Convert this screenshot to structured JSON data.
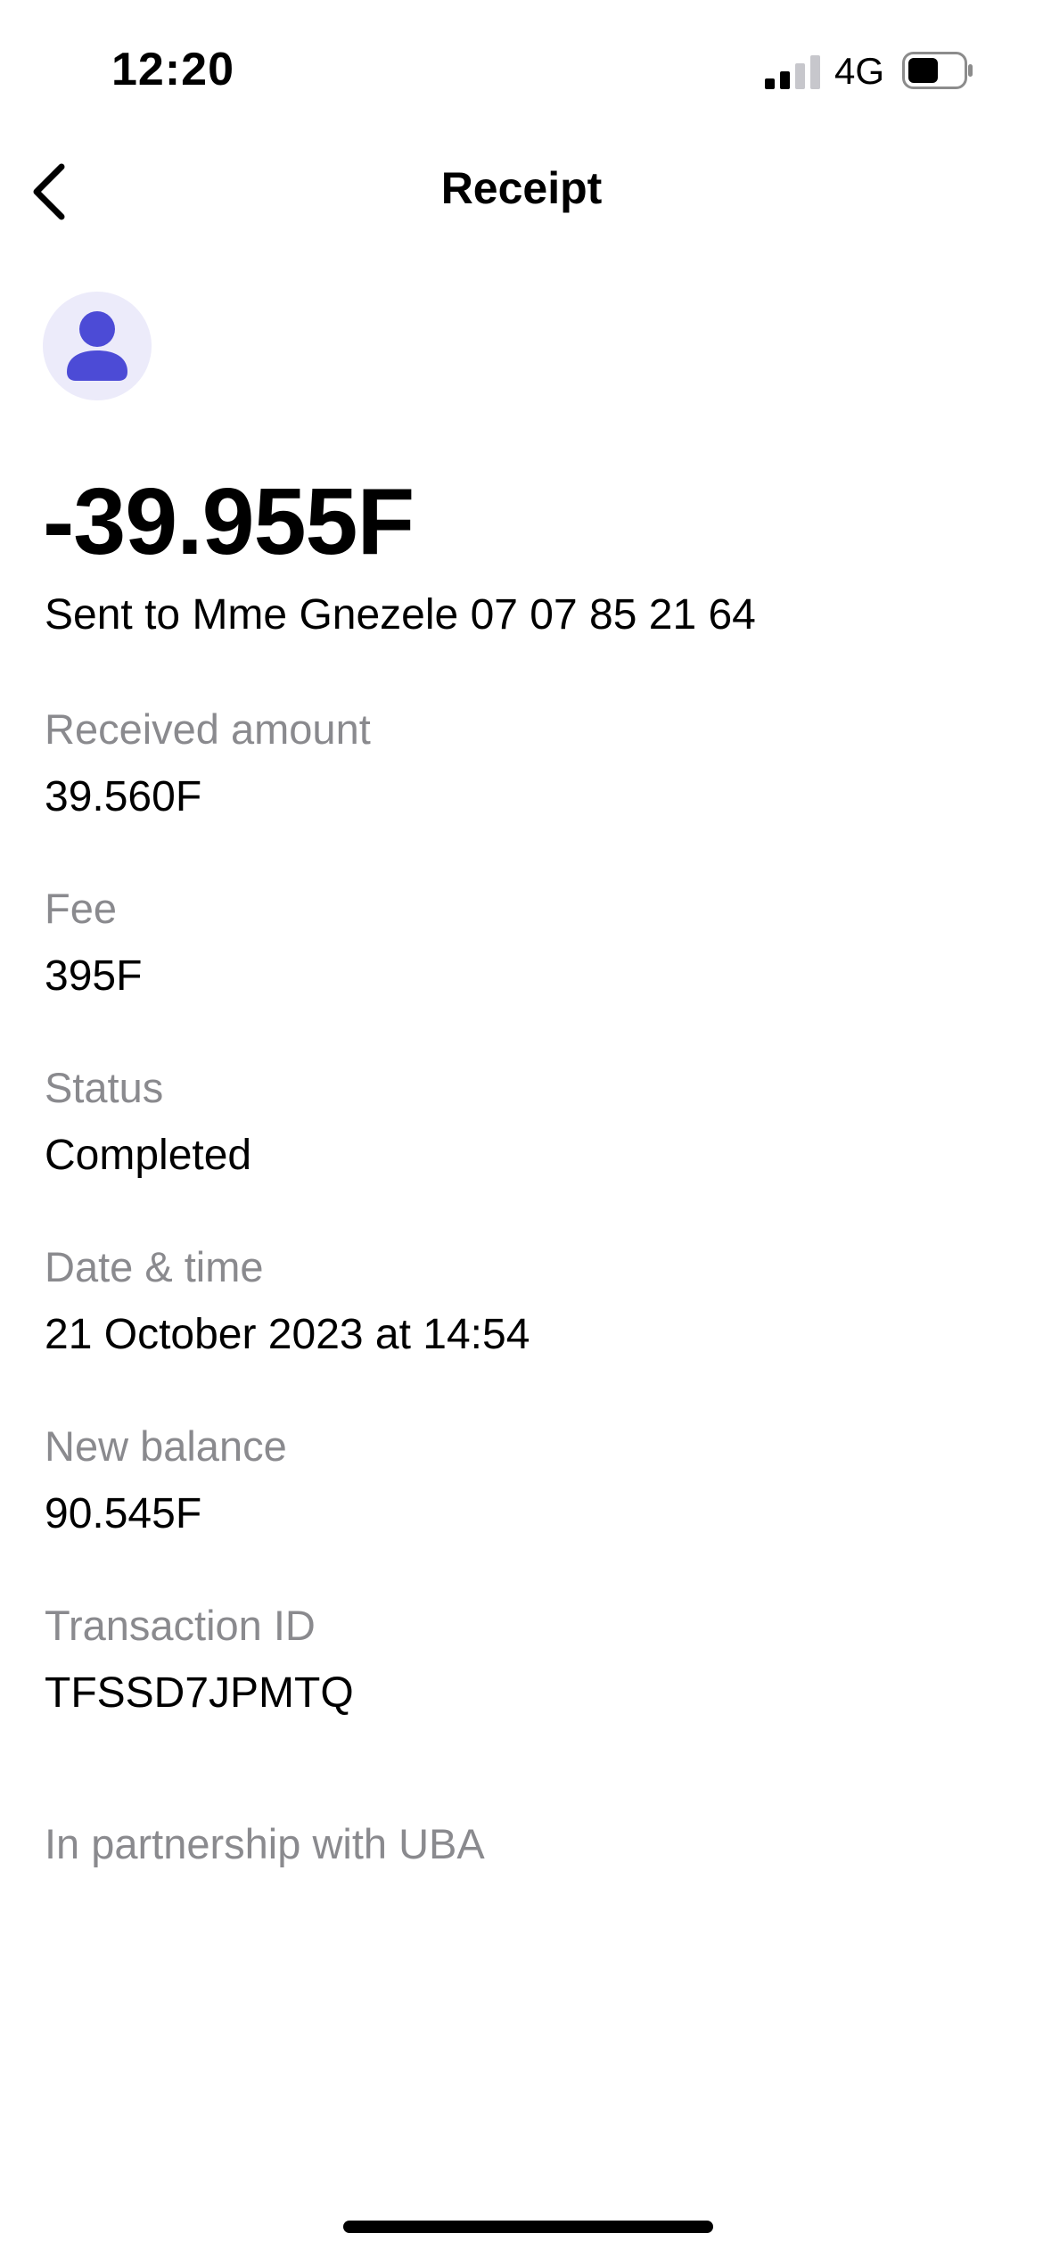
{
  "status_bar": {
    "time": "12:20",
    "network": "4G",
    "signal_bars_active": 2,
    "battery_level": 0.5
  },
  "nav": {
    "title": "Receipt",
    "back_icon": "chevron-left-icon"
  },
  "avatar": {
    "icon": "person-icon",
    "icon_color": "#4c4bd6",
    "background_color": "#ecebfa"
  },
  "transaction": {
    "amount": "-39.955F",
    "sent_to": "Sent to Mme Gnezele 07 07 85 21 64"
  },
  "details": [
    {
      "label": "Received amount",
      "value": "39.560F"
    },
    {
      "label": "Fee",
      "value": "395F"
    },
    {
      "label": "Status",
      "value": "Completed"
    },
    {
      "label": "Date & time",
      "value": "21 October 2023 at 14:54"
    },
    {
      "label": "New balance",
      "value": "90.545F"
    },
    {
      "label": "Transaction ID",
      "value": "TFSSD7JPMTQ"
    }
  ],
  "footer": {
    "partnership": "In partnership with UBA"
  }
}
